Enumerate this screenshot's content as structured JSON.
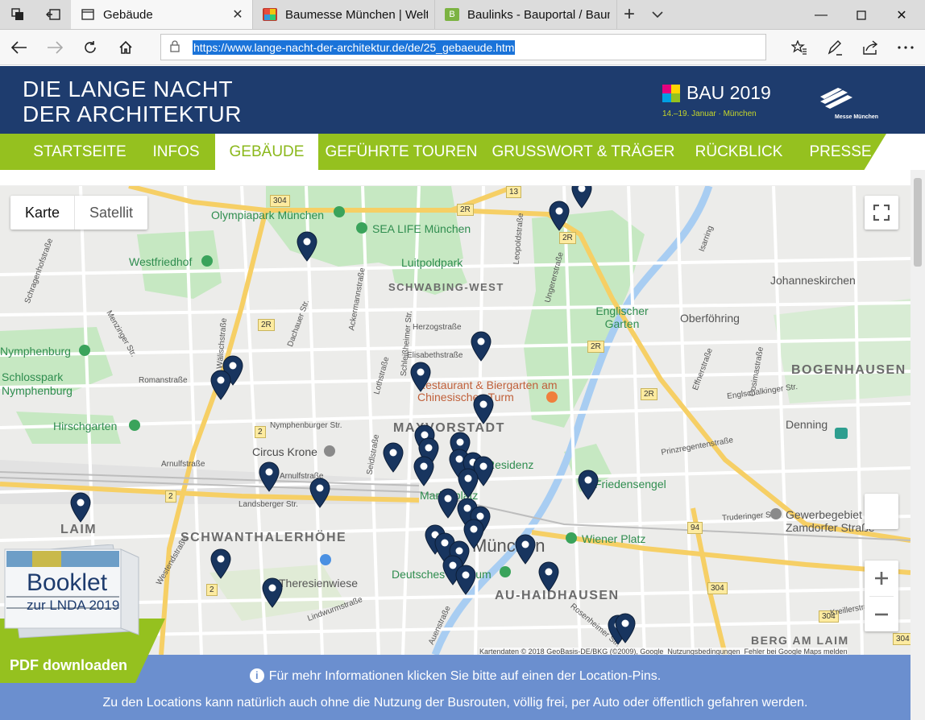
{
  "browser": {
    "tabs": [
      {
        "title": "Gebäude",
        "active": true,
        "favicon": "page-icon"
      },
      {
        "title": "Baumesse München | Weltle",
        "active": false,
        "favicon": "bau-icon"
      },
      {
        "title": "Baulinks - Bauportal / Baum",
        "active": false,
        "favicon": "b-icon"
      }
    ],
    "url": "https://www.lange-nacht-der-architektur.de/de/25_gebaeude.htm"
  },
  "site": {
    "title_line1": "DIE LANGE NACHT",
    "title_line2": "DER ARCHITEKTUR",
    "bau_logo": {
      "name": "BAU 2019",
      "dates": "14.–19. Januar · München"
    },
    "messe_logo": "Messe München",
    "menu": [
      "STARTSEITE",
      "INFOS",
      "GEBÄUDE",
      "GEFÜHRTE TOUREN",
      "GRUSSWORT & TRÄGER",
      "RÜCKBLICK",
      "PRESSE"
    ],
    "active_menu": "GEBÄUDE"
  },
  "map": {
    "type_buttons": [
      "Karte",
      "Satellit"
    ],
    "districts": [
      "SCHWABING-WEST",
      "MAXVORSTADT",
      "SCHWANTHALERHÖHE",
      "AU-HAIDHAUSEN",
      "BOGENHAUSEN",
      "LAIM",
      "BERG AM LAIM"
    ],
    "city": "München",
    "places": [
      "Olympiapark München",
      "SEA LIFE München",
      "Luitpoldpark",
      "Westfriedhof",
      "Englischer Garten",
      "Oberföhring",
      "Johanneskirchen",
      "Nymphenburg",
      "Schlosspark Nymphenburg",
      "Hirschgarten",
      "Restaurant & Biergarten am Chinesischen Turm",
      "Circus Krone",
      "Denning",
      "Friedensengel",
      "Gewerbegebiet Zamdorfer Straße",
      "Wiener Platz",
      "Deutsches Museum",
      "Theresienwiese",
      "Marienplatz",
      "Residenz"
    ],
    "streets": [
      "Romanstraße",
      "Dachauer Str.",
      "Herzogstraße",
      "Elisabethstraße",
      "Leopoldstraße",
      "Ungererstraße",
      "Nymphenburger Str.",
      "Arnulfstraße",
      "Landsberger Str.",
      "Lindwurmstraße",
      "Rosenheimer Str.",
      "Effnerstraße",
      "Englschalkinger Str.",
      "Truderinger Str.",
      "Westendstraße",
      "Ackermannstraße",
      "Schleißheimer Str.",
      "Lothstraße",
      "Seidlstraße",
      "Auenstraße",
      "Cosimastraße",
      "Isarring",
      "Kreillerstraße",
      "Wälischstraße",
      "Menzinger Str.",
      "Schragenhofstraße",
      "Arnulfstraße",
      "Prinzregentenstraße"
    ],
    "road_labels": [
      "304",
      "2R",
      "2R",
      "2R",
      "2R",
      "2R",
      "13",
      "2",
      "2",
      "2",
      "304",
      "304",
      "304",
      "94"
    ],
    "attribution": "Kartendaten © 2018 GeoBasis-DE/BKG (©2009), Google",
    "terms": "Nutzungsbedingungen",
    "report": "Fehler bei Google Maps melden"
  },
  "booklet": {
    "title": "Booklet",
    "subtitle": "zur LNDA 2019",
    "button": "PDF downloaden"
  },
  "info": {
    "line1": "Für mehr Informationen klicken Sie bitte auf einen der Location-Pins.",
    "line2": "Zu den Locations kann natürlich auch ohne die Nutzung der Busrouten, völlig frei, per Auto oder öffentlich gefahren werden."
  },
  "colors": {
    "header_navy": "#1e3c6e",
    "menu_green": "#95c11f",
    "pin_navy": "#18355f",
    "info_blue": "#6b8fcf",
    "park_green": "#c6e8c2",
    "highway_yellow": "#f6cf65"
  }
}
